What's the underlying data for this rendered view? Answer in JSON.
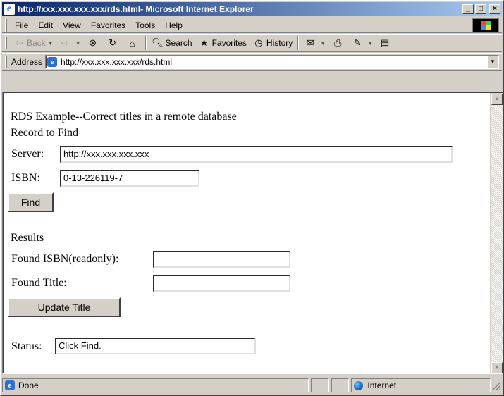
{
  "window": {
    "title": "http://xxx.xxx.xxx.xxx/rds.html- Microsoft Internet Explorer",
    "minimize_glyph": "_",
    "maximize_glyph": "□",
    "close_glyph": "×"
  },
  "menu": {
    "items": [
      {
        "label": "File"
      },
      {
        "label": "Edit"
      },
      {
        "label": "View"
      },
      {
        "label": "Favorites"
      },
      {
        "label": "Tools"
      },
      {
        "label": "Help"
      }
    ]
  },
  "toolbar": {
    "back_label": "Back",
    "search_label": "Search",
    "favorites_label": "Favorites",
    "history_label": "History"
  },
  "address": {
    "label": "Address",
    "url": "http://xxx.xxx.xxx.xxx/rds.html"
  },
  "page": {
    "heading": "RDS Example--Correct titles in a remote database",
    "record_heading": "Record to Find",
    "server_label": "Server:",
    "server_value": "http://xxx.xxx.xxx.xxx",
    "isbn_label": "ISBN:",
    "isbn_value": "0-13-226119-7",
    "find_button": "Find",
    "results_heading": "Results",
    "found_isbn_label": "Found ISBN(readonly):",
    "found_isbn_value": "",
    "found_title_label": "Found Title:",
    "found_title_value": "",
    "update_button": "Update Title",
    "status_label": "Status:",
    "status_value": "Click Find."
  },
  "statusbar": {
    "text": "Done",
    "zone": "Internet"
  },
  "colors": {
    "titlebar_start": "#0a246a",
    "titlebar_end": "#a6caf0",
    "chrome": "#d4d0c8"
  },
  "icons": [
    "ie-icon",
    "back-arrow-icon",
    "forward-arrow-icon",
    "stop-icon",
    "refresh-icon",
    "home-icon",
    "search-icon",
    "favorites-icon",
    "history-icon",
    "mail-icon",
    "print-icon",
    "edit-icon",
    "discuss-icon",
    "windows-logo-icon",
    "globe-icon"
  ]
}
